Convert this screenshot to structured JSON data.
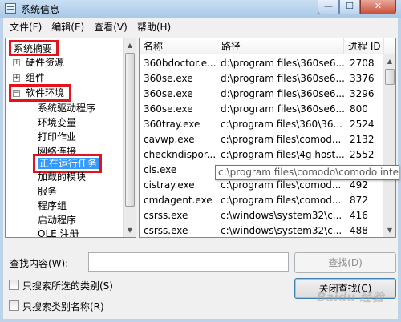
{
  "window": {
    "title": "系统信息",
    "minimize_glyph": "—",
    "maximize_glyph": "☐",
    "close_glyph": "✕"
  },
  "menu": [
    "文件(F)",
    "编辑(E)",
    "查看(V)",
    "帮助(H)"
  ],
  "tree": {
    "root": "系统摘要",
    "items": [
      {
        "label": "硬件资源",
        "expander": "+"
      },
      {
        "label": "组件",
        "expander": "+"
      },
      {
        "label": "软件环境",
        "expander": "−"
      }
    ],
    "children": [
      "系统驱动程序",
      "环境变量",
      "打印作业",
      "网络连接",
      "正在运行任务",
      "加载的模块",
      "服务",
      "程序组",
      "启动程序",
      "OLE 注册"
    ],
    "selected": "正在运行任务"
  },
  "list": {
    "columns": [
      "名称",
      "路径",
      "进程 ID"
    ],
    "rows": [
      [
        "360bdoctor.e...",
        "d:\\program files\\360se6...",
        "2708"
      ],
      [
        "360se.exe",
        "d:\\program files\\360se6...",
        "3376"
      ],
      [
        "360se.exe",
        "d:\\program files\\360se6...",
        "3296"
      ],
      [
        "360se.exe",
        "d:\\program files\\360se6...",
        "800"
      ],
      [
        "360tray.exe",
        "c:\\program files\\360\\36...",
        "2524"
      ],
      [
        "cavwp.exe",
        "c:\\program files\\comod...",
        "2132"
      ],
      [
        "checkndispor...",
        "c:\\program files\\4g host...",
        "2552"
      ],
      [
        "cis.exe",
        "",
        ""
      ],
      [
        "cistray.exe",
        "c:\\program files\\comod...",
        "492"
      ],
      [
        "cmdagent.exe",
        "c:\\program files\\comod...",
        "872"
      ],
      [
        "csrss.exe",
        "c:\\windows\\system32\\c...",
        "416"
      ],
      [
        "csrss.exe",
        "c:\\windows\\system32\\c...",
        "488"
      ]
    ],
    "tooltip": "c:\\program files\\comodo\\comodo inter"
  },
  "search": {
    "label": "查找内容(W):",
    "value": "",
    "find_button": "查找(D)",
    "close_button": "关闭查找(C)",
    "option1": "只搜索所选的类别(S)",
    "option2": "只搜索类别名称(R)"
  },
  "watermark": "Baidu 经验",
  "colors": {
    "highlight_box": "#e8101a",
    "selection": "#3399ff",
    "title_bar": "#bcd3ea"
  }
}
